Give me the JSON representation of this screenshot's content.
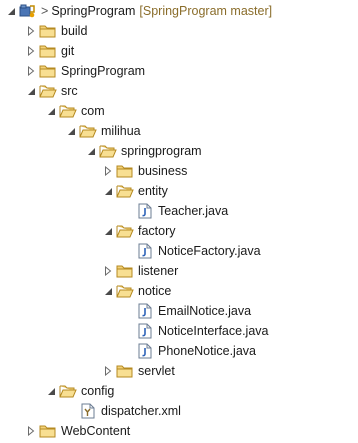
{
  "tree": {
    "project": {
      "prefix": ">",
      "name": "SpringProgram",
      "decoration": "[SpringProgram master]"
    },
    "items": [
      {
        "label": "build"
      },
      {
        "label": "git"
      },
      {
        "label": "SpringProgram"
      },
      {
        "label": "src"
      },
      {
        "label": "com"
      },
      {
        "label": "milihua"
      },
      {
        "label": "springprogram"
      },
      {
        "label": "business"
      },
      {
        "label": "entity"
      },
      {
        "label": "Teacher.java"
      },
      {
        "label": "factory"
      },
      {
        "label": "NoticeFactory.java"
      },
      {
        "label": "listener"
      },
      {
        "label": "notice"
      },
      {
        "label": "EmailNotice.java"
      },
      {
        "label": "NoticeInterface.java"
      },
      {
        "label": "PhoneNotice.java"
      },
      {
        "label": "servlet"
      },
      {
        "label": "config"
      },
      {
        "label": "dispatcher.xml"
      },
      {
        "label": "WebContent"
      }
    ]
  }
}
